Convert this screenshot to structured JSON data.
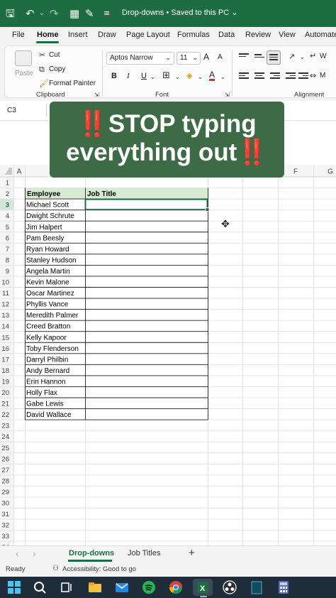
{
  "titlebar": {
    "doc_title": "Drop-downs • Saved to this PC ⌄",
    "icons": [
      "save-icon",
      "undo-icon",
      "redo-icon",
      "layout-icon",
      "form-icon",
      "customize-icon"
    ]
  },
  "menu": {
    "items": [
      "File",
      "Home",
      "Insert",
      "Draw",
      "Page Layout",
      "Formulas",
      "Data",
      "Review",
      "View",
      "Automate"
    ],
    "active": "Home"
  },
  "ribbon": {
    "clipboard": {
      "paste": "Paste",
      "cut": "Cut",
      "copy": "Copy",
      "format_painter": "Format Painter",
      "label": "Clipboard"
    },
    "font": {
      "name": "Aptos Narrow",
      "size": "11",
      "bold": "B",
      "italic": "I",
      "underline": "U",
      "grow": "A",
      "shrink": "A",
      "font_color": "A",
      "label": "Font"
    },
    "alignment": {
      "label": "Alignment",
      "wrap": "W",
      "merge": "M"
    }
  },
  "formula_bar": {
    "name_box": "C3"
  },
  "banner": {
    "line1": "‼️STOP typing",
    "line2": "everything out‼️"
  },
  "columns": [
    "A",
    "F",
    "G"
  ],
  "sheet": {
    "headers": [
      "Employee",
      "Job Title"
    ],
    "employees": [
      "Michael Scott",
      "Dwight Schrute",
      "Jim Halpert",
      "Pam Beesly",
      "Ryan Howard",
      "Stanley Hudson",
      "Angela Martin",
      "Kevin Malone",
      "Oscar Martinez",
      "Phyllis Vance",
      "Meredith Palmer",
      "Creed Bratton",
      "Kelly Kapoor",
      "Toby Flenderson",
      "Darryl Philbin",
      "Andy Bernard",
      "Erin Hannon",
      "Holly Flax",
      "Gabe Lewis",
      "David Wallace"
    ],
    "row_numbers": [
      "1",
      "2",
      "3",
      "4",
      "5",
      "6",
      "7",
      "8",
      "9",
      "10",
      "11",
      "12",
      "13",
      "14",
      "15",
      "16",
      "17",
      "18",
      "19",
      "20",
      "21",
      "22",
      "23",
      "24",
      "25",
      "26",
      "27",
      "28",
      "29",
      "30",
      "31",
      "32",
      "33",
      "34"
    ],
    "selected_row": "3"
  },
  "sheet_tabs": {
    "nav_prev": "‹",
    "nav_next": "›",
    "tabs": [
      "Drop-downs",
      "Job Titles"
    ],
    "active": "Drop-downs",
    "add": "+"
  },
  "status": {
    "ready": "Ready",
    "accessibility": "Accessibility: Good to go"
  },
  "colors": {
    "excel_green": "#1e6c41",
    "banner_green": "#3c6b45",
    "header_fill": "#d9ead3",
    "taskbar": "#1f2d3a"
  }
}
